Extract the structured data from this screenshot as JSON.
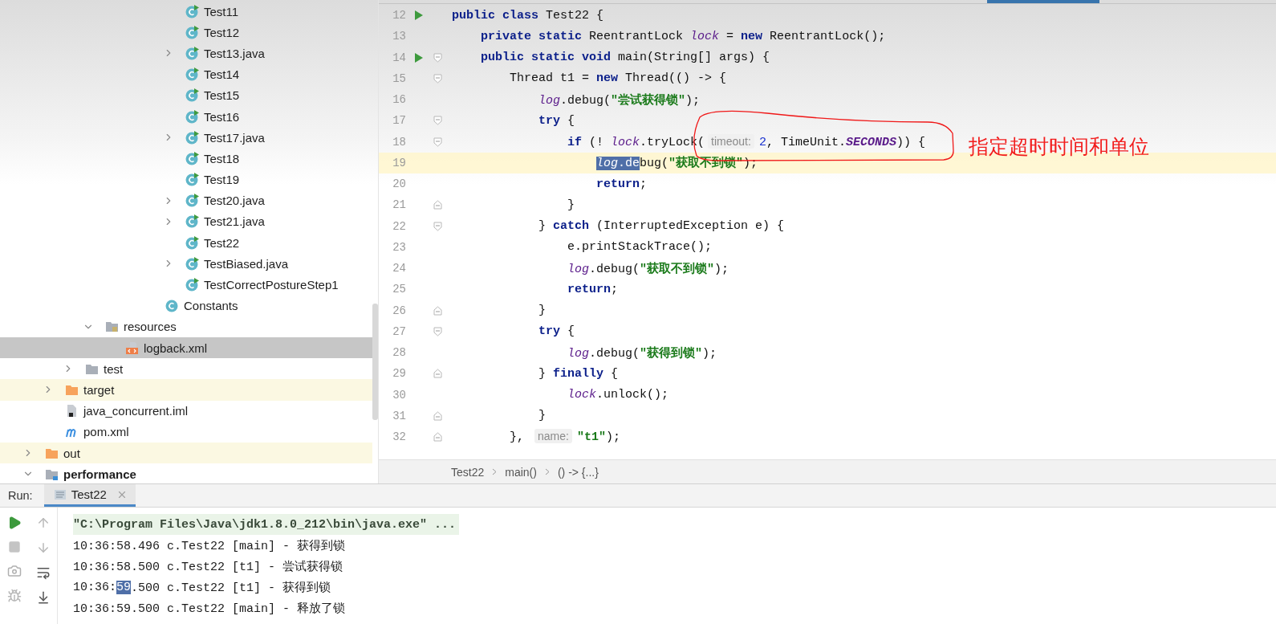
{
  "project_tree": {
    "items": [
      {
        "children": [
          {
            "children": [
              {
                "children": [
                  {
                    "children": [
                      {
                        "children": [
                          {
                            "children": [
                              {
                                "children": [
                                  {
                                    "label": "Test11",
                                    "kind": "class",
                                    "selected": false
                                  },
                                  {
                                    "label": "Test12",
                                    "kind": "class",
                                    "selected": false
                                  },
                                  {
                                    "label": "Test13.java",
                                    "kind": "class",
                                    "expanded": false,
                                    "selected": false
                                  },
                                  {
                                    "label": "Test14",
                                    "kind": "class",
                                    "selected": false
                                  },
                                  {
                                    "label": "Test15",
                                    "kind": "class",
                                    "selected": false
                                  },
                                  {
                                    "label": "Test16",
                                    "kind": "class",
                                    "selected": false
                                  },
                                  {
                                    "label": "Test17.java",
                                    "kind": "class",
                                    "expanded": false,
                                    "selected": false
                                  },
                                  {
                                    "label": "Test18",
                                    "kind": "class",
                                    "selected": false
                                  },
                                  {
                                    "label": "Test19",
                                    "kind": "class",
                                    "selected": false
                                  },
                                  {
                                    "label": "Test20.java",
                                    "kind": "class",
                                    "expanded": false,
                                    "selected": false
                                  },
                                  {
                                    "label": "Test21.java",
                                    "kind": "class",
                                    "expanded": false,
                                    "selected": false
                                  },
                                  {
                                    "label": "Test22",
                                    "kind": "class",
                                    "selected": false
                                  },
                                  {
                                    "label": "TestBiased.java",
                                    "kind": "class",
                                    "expanded": false,
                                    "selected": false
                                  },
                                  {
                                    "label": "TestCorrectPostureStep1",
                                    "kind": "class",
                                    "selected": false
                                  }
                                ]
                              },
                              {
                                "label": "Constants",
                                "kind": "plain-class",
                                "selected": false
                              }
                            ]
                          }
                        ]
                      }
                    ]
                  },
                  {
                    "label": "resources",
                    "kind": "resources-folder",
                    "expanded": true,
                    "selected": false,
                    "children": [
                      {
                        "label": "logback.xml",
                        "kind": "xml-file",
                        "selected": true
                      }
                    ]
                  }
                ]
              },
              {
                "label": "test",
                "kind": "folder",
                "expanded": false,
                "selected": false
              }
            ]
          },
          {
            "label": "target",
            "kind": "excluded-folder",
            "expanded": false,
            "selected": false
          },
          {
            "label": "java_concurrent.iml",
            "kind": "iml-file",
            "selected": false
          },
          {
            "label": "pom.xml",
            "kind": "maven-file",
            "selected": false
          }
        ]
      },
      {
        "label": "out",
        "kind": "excluded-folder",
        "expanded": false,
        "selected": false
      },
      {
        "label": "performance",
        "kind": "module",
        "expanded": true,
        "selected": false
      }
    ]
  },
  "editor": {
    "lines": [
      {
        "number": "12",
        "run_marker": true,
        "current": false,
        "fold_start": false,
        "fold_end": false,
        "tokens": [
          {
            "text": "public class",
            "kind": "keyword",
            "selected": false
          },
          {
            "text": " Test22 {",
            "kind": "plain",
            "selected": false
          }
        ],
        "children": [
          {
            "number": "13",
            "run_marker": false,
            "current": false,
            "fold_start": false,
            "fold_end": false,
            "tokens": [
              {
                "text": "private static",
                "kind": "keyword",
                "selected": false
              },
              {
                "text": " ReentrantLock ",
                "kind": "plain",
                "selected": false
              },
              {
                "text": "lock",
                "kind": "field",
                "selected": false
              },
              {
                "text": " = ",
                "kind": "plain",
                "selected": false
              },
              {
                "text": "new",
                "kind": "keyword",
                "selected": false
              },
              {
                "text": " ReentrantLock();",
                "kind": "plain",
                "selected": false
              }
            ]
          },
          {
            "number": "14",
            "run_marker": true,
            "current": false,
            "fold_start": true,
            "fold_end": false,
            "tokens": [
              {
                "text": "public static void",
                "kind": "keyword",
                "selected": false
              },
              {
                "text": " main(String[] args) {",
                "kind": "plain",
                "selected": false
              }
            ],
            "children": [
              {
                "number": "15",
                "run_marker": false,
                "current": false,
                "fold_start": true,
                "fold_end": false,
                "tokens": [
                  {
                    "text": "Thread t1 = ",
                    "kind": "plain",
                    "selected": false
                  },
                  {
                    "text": "new",
                    "kind": "keyword",
                    "selected": false
                  },
                  {
                    "text": " Thread(() -> {",
                    "kind": "plain",
                    "selected": false
                  }
                ],
                "children": [
                  {
                    "number": "16",
                    "run_marker": false,
                    "current": false,
                    "fold_start": false,
                    "fold_end": false,
                    "tokens": [
                      {
                        "text": "log",
                        "kind": "field",
                        "selected": false
                      },
                      {
                        "text": ".debug(",
                        "kind": "plain",
                        "selected": false
                      },
                      {
                        "text": "\"尝试获得锁\"",
                        "kind": "string",
                        "selected": false
                      },
                      {
                        "text": ");",
                        "kind": "plain",
                        "selected": false
                      }
                    ]
                  },
                  {
                    "number": "17",
                    "run_marker": false,
                    "current": false,
                    "fold_start": true,
                    "fold_end": false,
                    "tokens": [
                      {
                        "text": "try",
                        "kind": "keyword",
                        "selected": false
                      },
                      {
                        "text": " {",
                        "kind": "plain",
                        "selected": false
                      }
                    ],
                    "children": [
                      {
                        "number": "18",
                        "run_marker": false,
                        "current": false,
                        "fold_start": true,
                        "fold_end": false,
                        "tokens": [
                          {
                            "text": "if",
                            "kind": "keyword",
                            "selected": false
                          },
                          {
                            "text": " (! ",
                            "kind": "plain",
                            "selected": false
                          },
                          {
                            "text": "lock",
                            "kind": "field",
                            "selected": false
                          },
                          {
                            "text": ".tryLock(",
                            "kind": "plain",
                            "selected": false
                          },
                          {
                            "text": "timeout:",
                            "kind": "hint",
                            "selected": false
                          },
                          {
                            "text": "2",
                            "kind": "number",
                            "selected": false
                          },
                          {
                            "text": ", TimeUnit.",
                            "kind": "plain",
                            "selected": false
                          },
                          {
                            "text": "SECONDS",
                            "kind": "constant",
                            "selected": false
                          },
                          {
                            "text": ")) {",
                            "kind": "plain",
                            "selected": false
                          }
                        ],
                        "children": [
                          {
                            "number": "19",
                            "run_marker": false,
                            "current": true,
                            "fold_start": false,
                            "fold_end": false,
                            "tokens": [
                              {
                                "text": "log",
                                "kind": "field",
                                "selected": true
                              },
                              {
                                "text": ".de",
                                "kind": "plain",
                                "selected": true
                              },
                              {
                                "text": "bug(",
                                "kind": "plain",
                                "selected": false
                              },
                              {
                                "text": "\"获取不到锁\"",
                                "kind": "string",
                                "selected": false
                              },
                              {
                                "text": ");",
                                "kind": "plain",
                                "selected": false
                              }
                            ]
                          },
                          {
                            "number": "20",
                            "run_marker": false,
                            "current": false,
                            "fold_start": false,
                            "fold_end": false,
                            "tokens": [
                              {
                                "text": "return",
                                "kind": "keyword",
                                "selected": false
                              },
                              {
                                "text": ";",
                                "kind": "plain",
                                "selected": false
                              }
                            ]
                          }
                        ]
                      },
                      {
                        "number": "21",
                        "run_marker": false,
                        "current": false,
                        "fold_start": false,
                        "fold_end": true,
                        "tokens": [
                          {
                            "text": "}",
                            "kind": "plain",
                            "selected": false
                          }
                        ]
                      }
                    ]
                  },
                  {
                    "number": "22",
                    "run_marker": false,
                    "current": false,
                    "fold_start": true,
                    "fold_end": false,
                    "tokens": [
                      {
                        "text": "} ",
                        "kind": "plain",
                        "selected": false
                      },
                      {
                        "text": "catch",
                        "kind": "keyword",
                        "selected": false
                      },
                      {
                        "text": " (InterruptedException e) {",
                        "kind": "plain",
                        "selected": false
                      }
                    ],
                    "children": [
                      {
                        "number": "23",
                        "run_marker": false,
                        "current": false,
                        "fold_start": false,
                        "fold_end": false,
                        "tokens": [
                          {
                            "text": "e.printStackTrace();",
                            "kind": "plain",
                            "selected": false
                          }
                        ]
                      },
                      {
                        "number": "24",
                        "run_marker": false,
                        "current": false,
                        "fold_start": false,
                        "fold_end": false,
                        "tokens": [
                          {
                            "text": "log",
                            "kind": "field",
                            "selected": false
                          },
                          {
                            "text": ".debug(",
                            "kind": "plain",
                            "selected": false
                          },
                          {
                            "text": "\"获取不到锁\"",
                            "kind": "string",
                            "selected": false
                          },
                          {
                            "text": ");",
                            "kind": "plain",
                            "selected": false
                          }
                        ]
                      },
                      {
                        "number": "25",
                        "run_marker": false,
                        "current": false,
                        "fold_start": false,
                        "fold_end": false,
                        "tokens": [
                          {
                            "text": "return",
                            "kind": "keyword",
                            "selected": false
                          },
                          {
                            "text": ";",
                            "kind": "plain",
                            "selected": false
                          }
                        ]
                      }
                    ]
                  },
                  {
                    "number": "26",
                    "run_marker": false,
                    "current": false,
                    "fold_start": false,
                    "fold_end": true,
                    "tokens": [
                      {
                        "text": "}",
                        "kind": "plain",
                        "selected": false
                      }
                    ]
                  },
                  {
                    "number": "27",
                    "run_marker": false,
                    "current": false,
                    "fold_start": true,
                    "fold_end": false,
                    "tokens": [
                      {
                        "text": "try",
                        "kind": "keyword",
                        "selected": false
                      },
                      {
                        "text": " {",
                        "kind": "plain",
                        "selected": false
                      }
                    ],
                    "children": [
                      {
                        "number": "28",
                        "run_marker": false,
                        "current": false,
                        "fold_start": false,
                        "fold_end": false,
                        "tokens": [
                          {
                            "text": "log",
                            "kind": "field",
                            "selected": false
                          },
                          {
                            "text": ".debug(",
                            "kind": "plain",
                            "selected": false
                          },
                          {
                            "text": "\"获得到锁\"",
                            "kind": "string",
                            "selected": false
                          },
                          {
                            "text": ");",
                            "kind": "plain",
                            "selected": false
                          }
                        ]
                      }
                    ]
                  },
                  {
                    "number": "29",
                    "run_marker": false,
                    "current": false,
                    "fold_start": false,
                    "fold_end": true,
                    "tokens": [
                      {
                        "text": "} ",
                        "kind": "plain",
                        "selected": false
                      },
                      {
                        "text": "finally",
                        "kind": "keyword",
                        "selected": false
                      },
                      {
                        "text": " {",
                        "kind": "plain",
                        "selected": false
                      }
                    ],
                    "children": [
                      {
                        "number": "30",
                        "run_marker": false,
                        "current": false,
                        "fold_start": false,
                        "fold_end": false,
                        "tokens": [
                          {
                            "text": "lock",
                            "kind": "field",
                            "selected": false
                          },
                          {
                            "text": ".unlock();",
                            "kind": "plain",
                            "selected": false
                          }
                        ]
                      }
                    ]
                  },
                  {
                    "number": "31",
                    "run_marker": false,
                    "current": false,
                    "fold_start": false,
                    "fold_end": true,
                    "tokens": [
                      {
                        "text": "}",
                        "kind": "plain",
                        "selected": false
                      }
                    ]
                  }
                ]
              },
              {
                "number": "32",
                "run_marker": false,
                "current": false,
                "fold_start": false,
                "fold_end": true,
                "tokens": [
                  {
                    "text": "}, ",
                    "kind": "plain",
                    "selected": false
                  },
                  {
                    "text": "name:",
                    "kind": "hint",
                    "selected": false
                  },
                  {
                    "text": "\"t1\"",
                    "kind": "string",
                    "selected": false
                  },
                  {
                    "text": ");",
                    "kind": "plain",
                    "selected": false
                  }
                ]
              }
            ]
          }
        ]
      }
    ],
    "annotation": {
      "note": "指定超时时间和单位"
    },
    "breadcrumbs": [
      "Test22",
      "main()",
      "() -> {...}"
    ]
  },
  "run_panel": {
    "label": "Run:",
    "tabs": [
      {
        "label": "Test22",
        "selected": true
      }
    ],
    "console": [
      {
        "kind": "command",
        "parts": [
          {
            "text": "\"C:\\Program Files\\Java\\jdk1.8.0_212\\bin\\java.exe\" ...",
            "selected": false
          }
        ]
      },
      {
        "kind": "output",
        "parts": [
          {
            "text": "10:36:58.496 c.Test22 [main] - 获得到锁",
            "selected": false
          }
        ]
      },
      {
        "kind": "output",
        "parts": [
          {
            "text": "10:36:58.500 c.Test22 [t1] - 尝试获得锁",
            "selected": false
          }
        ]
      },
      {
        "kind": "output",
        "parts": [
          {
            "text": "10:36:",
            "selected": false
          },
          {
            "text": "59",
            "selected": true
          },
          {
            "text": ".500 c.Test22 [t1] - 获得到锁",
            "selected": false
          }
        ]
      },
      {
        "kind": "output",
        "parts": [
          {
            "text": "10:36:59.500 c.Test22 [main] - 释放了锁",
            "selected": false
          }
        ]
      }
    ]
  }
}
